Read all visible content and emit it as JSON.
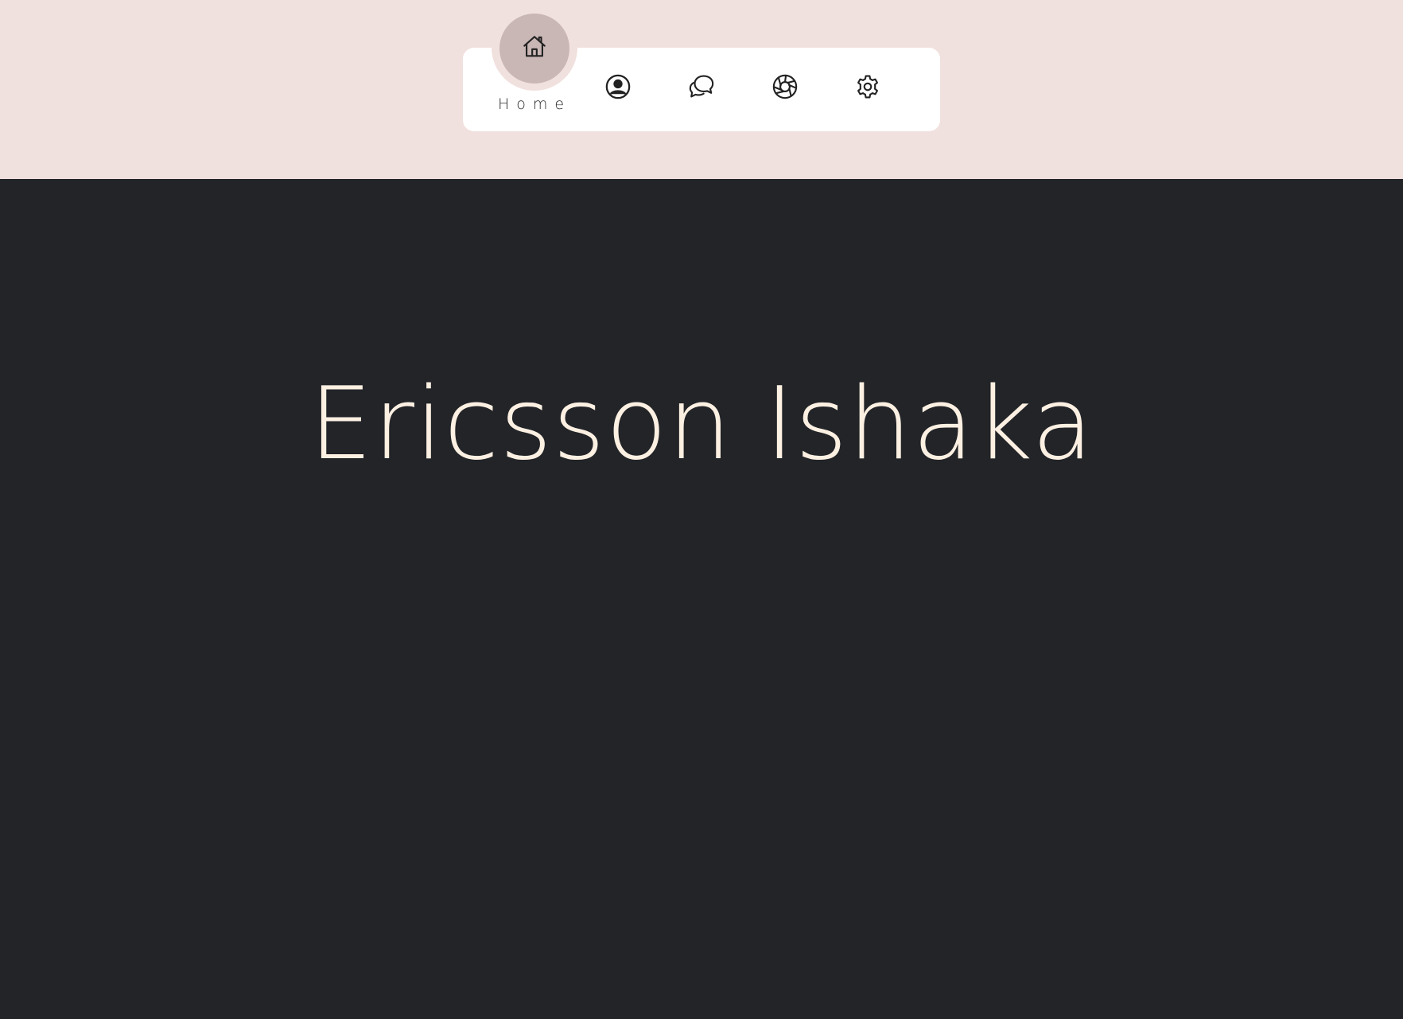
{
  "nav": {
    "active": {
      "label": "Home",
      "icon": "home-icon"
    },
    "items": [
      {
        "icon": "user-circle-icon"
      },
      {
        "icon": "chat-bubbles-icon"
      },
      {
        "icon": "aperture-icon"
      },
      {
        "icon": "gear-icon"
      }
    ]
  },
  "hero": {
    "name": "Ericsson Ishaka"
  },
  "colors": {
    "top_band": "#f1e1de",
    "nav_bar": "#ffffff",
    "active_bubble": "#c9b7b6",
    "background": "#222428",
    "hero_text": "#fcf0e2"
  }
}
